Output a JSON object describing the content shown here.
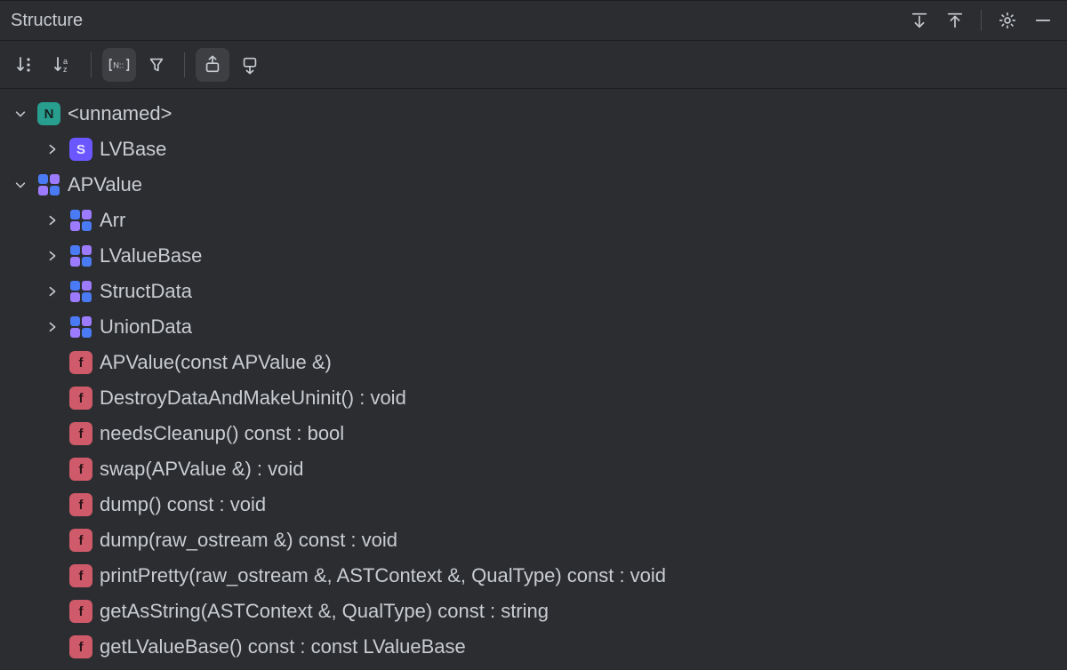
{
  "panel": {
    "title": "Structure"
  },
  "tree": {
    "root0": {
      "label": "<unnamed>"
    },
    "root0_child0": {
      "label": "LVBase"
    },
    "root1": {
      "label": "APValue"
    },
    "root1_children": {
      "c0": {
        "label": "Arr"
      },
      "c1": {
        "label": "LValueBase"
      },
      "c2": {
        "label": "StructData"
      },
      "c3": {
        "label": "UnionData"
      },
      "m0": {
        "label": "APValue(const APValue &)"
      },
      "m1": {
        "label": "DestroyDataAndMakeUninit() : void"
      },
      "m2": {
        "label": "needsCleanup() const : bool"
      },
      "m3": {
        "label": "swap(APValue &) : void"
      },
      "m4": {
        "label": "dump() const : void"
      },
      "m5": {
        "label": "dump(raw_ostream &) const : void"
      },
      "m6": {
        "label": "printPretty(raw_ostream &, ASTContext &, QualType) const : void"
      },
      "m7": {
        "label": "getAsString(ASTContext &, QualType) const : string"
      },
      "m8": {
        "label": "getLValueBase() const : const LValueBase"
      }
    }
  },
  "icons": {
    "expand_all": "expand-all-icon",
    "collapse_all": "collapse-all-icon",
    "gear": "gear-icon",
    "minimize": "minimize-icon",
    "sort_vis": "sort-visibility-icon",
    "sort_alpha": "sort-alpha-icon",
    "ns": "namespace-toggle-icon",
    "filter": "filter-icon",
    "scroll_top": "autoscroll-to-source-icon",
    "scroll_from": "autoscroll-from-source-icon"
  }
}
